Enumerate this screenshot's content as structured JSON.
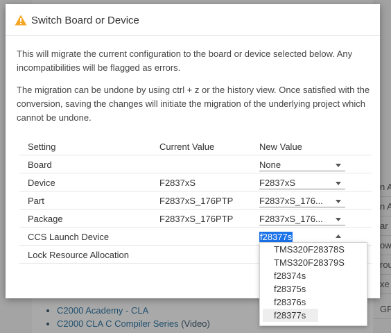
{
  "dialog": {
    "title": "Switch Board or Device",
    "paragraph1": "This will migrate the current configuration to the board or device selected below. Any incompatibilities will be flagged as errors.",
    "paragraph2": "The migration can be undone by using ctrl + z or the history view. Once satisfied with the conversion, saving the changes will initiate the migration of the underlying project which cannot be undone."
  },
  "table": {
    "headers": {
      "setting": "Setting",
      "current": "Current Value",
      "new": "New Value"
    },
    "rows": [
      {
        "setting": "Board",
        "current": "",
        "new": "None"
      },
      {
        "setting": "Device",
        "current": "F2837xS",
        "new": "F2837xS"
      },
      {
        "setting": "Part",
        "current": "F2837xS_176PTP",
        "new": "F2837xS_176..."
      },
      {
        "setting": "Package",
        "current": "F2837xS_176PTP",
        "new": "F2837xS_176..."
      },
      {
        "setting": "CCS Launch Device",
        "current": "",
        "new": "f28377s"
      },
      {
        "setting": "Lock Resource Allocation",
        "current": "",
        "new": ""
      }
    ]
  },
  "dropdown": {
    "options": [
      "TMS320F28378S",
      "TMS320F28379S",
      "f28374s",
      "f28375s",
      "f28376s",
      "f28377s"
    ],
    "selected": "f28377s"
  },
  "background": {
    "right_items": [
      "n A",
      "n A",
      "ar",
      "ow",
      "rou",
      "xe",
      "GPIO"
    ],
    "links": [
      {
        "text": "C2000 Academy - CLA",
        "suffix": ""
      },
      {
        "text": "C2000 CLA C Compiler Series",
        "suffix": " (Video)"
      }
    ]
  },
  "colors": {
    "accent": "#1a73e8",
    "warning": "#f5a623"
  }
}
